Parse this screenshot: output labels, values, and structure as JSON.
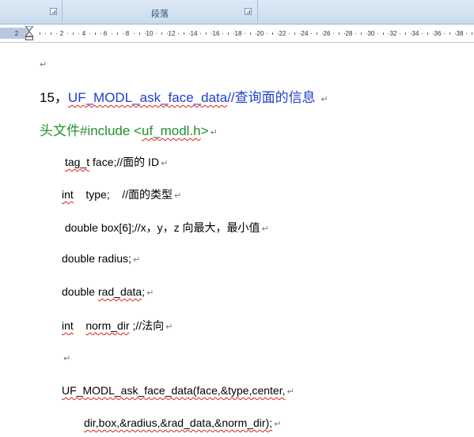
{
  "ribbon": {
    "group_label": "段落"
  },
  "ruler": {
    "numbers": [
      "2",
      "2",
      "4",
      "6",
      "8",
      "10",
      "12",
      "14",
      "16",
      "18",
      "20",
      "22",
      "24",
      "26",
      "28",
      "30",
      "32",
      "34",
      "36",
      "38"
    ]
  },
  "document": {
    "para_mark": "↵",
    "line0": "",
    "heading": {
      "num": "15，",
      "func": "UF_MODL_ask_face_data",
      "comment": "//查询面的信息"
    },
    "include": {
      "prefix": "头文件#include <",
      "file": "uf_modl.h",
      "suffix": ">"
    },
    "line_tag": {
      "a": "tag_t",
      "b": " face;//面的 ID"
    },
    "line_int": {
      "a": "int",
      "b": "    type;    //面的类型"
    },
    "line_box": " double box[6];//x，y，z 向最大，最小值",
    "line_radius": "double radius;",
    "line_rad": {
      "a": "double ",
      "b": "rad_data",
      "c": ";"
    },
    "line_norm": {
      "a": "int",
      "b": "    ",
      "c": "norm_dir",
      "d": " ;//法向"
    },
    "line_empty": "",
    "call1": "UF_MODL_ask_face_data(face,&type,center,",
    "call2": "dir,box,&radius,&rad_data,&norm_dir);"
  }
}
